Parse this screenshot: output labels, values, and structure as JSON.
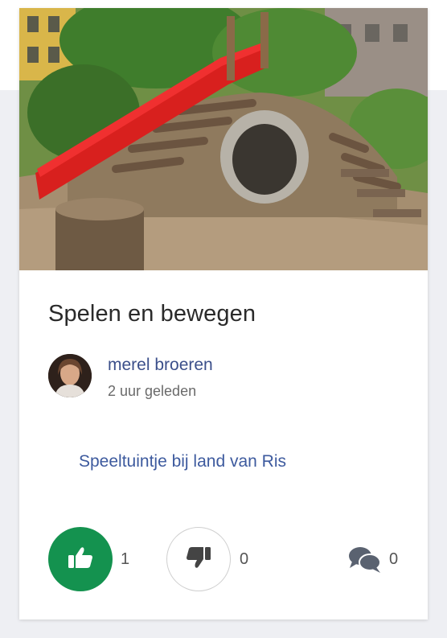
{
  "card": {
    "title": "Spelen en bewegen",
    "author": "merel broeren",
    "time": "2 uur geleden",
    "description": "Speeltuintje bij land van Ris"
  },
  "actions": {
    "like_count": "1",
    "dislike_count": "0",
    "comment_count": "0"
  },
  "icons": {
    "like": "thumbs-up-icon",
    "dislike": "thumbs-down-icon",
    "comments": "comments-icon"
  },
  "colors": {
    "like_green": "#14924f",
    "link_blue": "#3d5a9e",
    "author_blue": "#3b4f8a"
  }
}
